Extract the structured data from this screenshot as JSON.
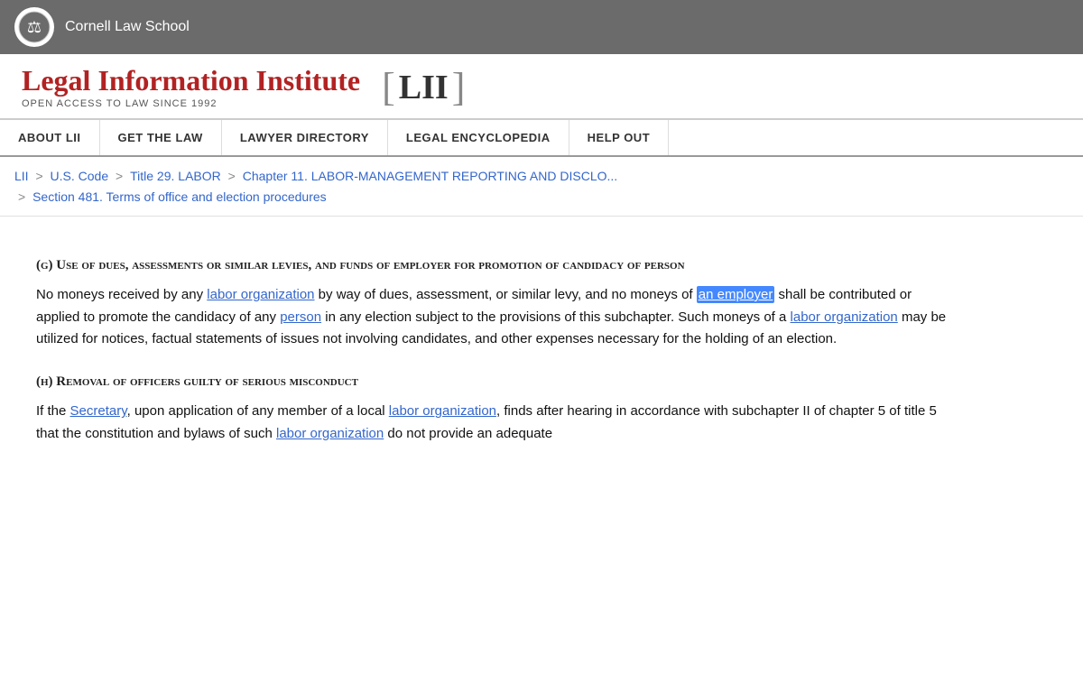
{
  "cornell": {
    "name": "Cornell Law School",
    "logo_symbol": "⚖"
  },
  "lii": {
    "title": "Legal Information Institute",
    "subtitle": "OPEN ACCESS TO LAW SINCE 1992",
    "bracket_text": "LII"
  },
  "nav": {
    "items": [
      "ABOUT LII",
      "GET THE LAW",
      "LAWYER DIRECTORY",
      "LEGAL ENCYCLOPEDIA",
      "HELP OUT"
    ]
  },
  "breadcrumb": {
    "lii": "LII",
    "us_code": "U.S. Code",
    "title": "Title 29. LABOR",
    "chapter": "Chapter 11. LABOR-MANAGEMENT REPORTING AND DISCLO...",
    "section": "Section 481. Terms of office and election procedures"
  },
  "content": {
    "section_g_heading": "(g) Use of dues, assessments or similar levies, and funds of employer for promotion of candidacy of person",
    "section_g_body_1": "No moneys received by any ",
    "section_g_link1": "labor organization",
    "section_g_body_2": " by way of dues, assessment, or similar levy, and no moneys of ",
    "section_g_highlighted": "an employer",
    "section_g_body_3": " shall be contributed or applied to promote the candidacy of any ",
    "section_g_link2": "person",
    "section_g_body_4": " in any election subject to the provisions of this subchapter. Such moneys of a ",
    "section_g_link3": "labor organization",
    "section_g_body_5": " may be utilized for notices, factual statements of issues not involving candidates, and other expenses necessary for the holding of an election.",
    "section_h_heading": "(h) Removal of officers guilty of serious misconduct",
    "section_h_body_1": "If the ",
    "section_h_link1": "Secretary",
    "section_h_body_2": ", upon application of any member of a local ",
    "section_h_link2": "labor organization",
    "section_h_body_3": ", finds after hearing in accordance with subchapter II of chapter 5 of title 5 that the constitution and bylaws of such ",
    "section_h_link3": "labor organization",
    "section_h_body_4": " do not provide an adequate"
  }
}
